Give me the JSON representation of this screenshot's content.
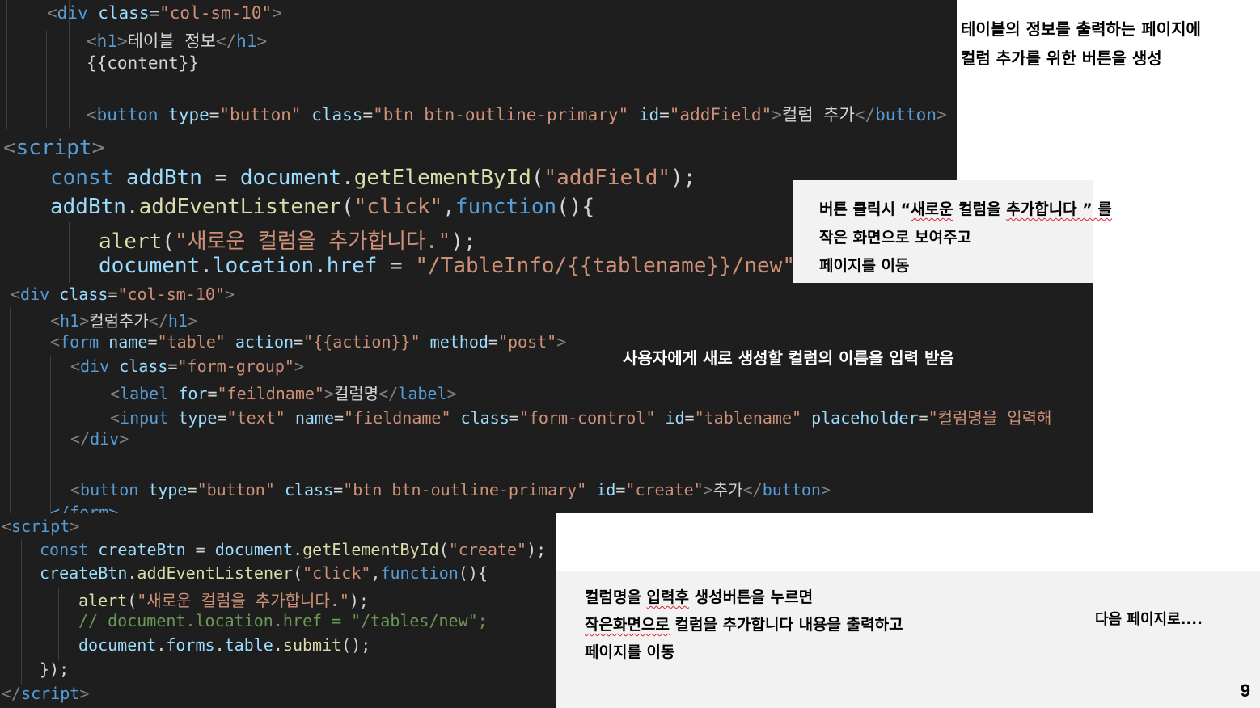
{
  "slide": {
    "page_number": "9",
    "next_page_note": "다음 페이지로....",
    "colors": {
      "editor_bg": "#1e1e1e",
      "note_bg": "#f2f2f2",
      "tag": "#569cd6",
      "attr": "#9cdcfe",
      "string": "#ce9178",
      "function": "#dcdcaa",
      "comment": "#6a9955"
    }
  },
  "code_top": {
    "line1": {
      "indent": "  ",
      "open": "<",
      "tag": "div",
      "attr": "class",
      "eq": "=",
      "val": "\"col-sm-10\"",
      "close": ">"
    },
    "line2": {
      "open": "<",
      "tag": "h1",
      "close": ">",
      "text": "테이블 정보",
      "end_open": "</",
      "end_tag": "h1",
      "end_close": ">"
    },
    "line3": {
      "text": "{{content}}"
    },
    "line4": {
      "open": "<",
      "tag": "button",
      "a1": "type",
      "v1": "\"button\"",
      "a2": "class",
      "v2": "\"btn btn-outline-primary\"",
      "a3": "id",
      "v3": "\"addField\"",
      "close": ">",
      "text": "컬럼 추가",
      "end_open": "</",
      "end_tag": "button",
      "end_close": ">"
    },
    "line5": {
      "open": "<",
      "tag": "script",
      "close": ">"
    },
    "line6": {
      "kw": "const",
      "var": "addBtn",
      "eq": " = ",
      "obj": "document",
      "dot": ".",
      "fn": "getElementById",
      "p1": "(",
      "str": "\"addField\"",
      "p2": ");"
    },
    "line7": {
      "var": "addBtn",
      "dot": ".",
      "fn": "addEventListener",
      "p1": "(",
      "str": "\"click\"",
      "comma": ",",
      "kw": "function",
      "p2": "(){"
    },
    "line8": {
      "fn": "alert",
      "p1": "(",
      "str": "\"새로운 컬럼을 추가합니다.\"",
      "p2": ");"
    },
    "line9": {
      "obj": "document",
      "dot1": ".",
      "p1": "location",
      "dot2": ".",
      "p2": "href",
      "eq": " = ",
      "str": "\"/TableInfo/{{tablename}}/new\"",
      "end": ";"
    }
  },
  "code_bottom": {
    "line1": {
      "open": "<",
      "tag": "div",
      "attr": "class",
      "eq": "=",
      "val": "\"col-sm-10\"",
      "close": ">"
    },
    "line2": {
      "open": "<",
      "tag": "h1",
      "close": ">",
      "text": "컬럼추가",
      "end_open": "</",
      "end_tag": "h1",
      "end_close": ">"
    },
    "line3": {
      "open": "<",
      "tag": "form",
      "a1": "name",
      "v1": "\"table\"",
      "a2": "action",
      "v2": "\"{{action}}\"",
      "a3": "method",
      "v3": "\"post\"",
      "close": ">"
    },
    "line4": {
      "open": "<",
      "tag": "div",
      "attr": "class",
      "val": "\"form-group\"",
      "close": ">"
    },
    "line5": {
      "open": "<",
      "tag": "label",
      "attr": "for",
      "val": "\"feildname\"",
      "close": ">",
      "text": "컬럼명",
      "end_open": "</",
      "end_tag": "label",
      "end_close": ">"
    },
    "line6": {
      "open": "<",
      "tag": "input",
      "a1": "type",
      "v1": "\"text\"",
      "a2": "name",
      "v2": "\"fieldname\"",
      "a3": "class",
      "v3": "\"form-control\"",
      "a4": "id",
      "v4": "\"tablename\"",
      "a5": "placeholder",
      "v5": "\"컬럼명을 입력해"
    },
    "line7": {
      "end_open": "</",
      "end_tag": "div",
      "end_close": ">"
    },
    "line8": {
      "open": "<",
      "tag": "button",
      "a1": "type",
      "v1": "\"button\"",
      "a2": "class",
      "v2": "\"btn btn-outline-primary\"",
      "a3": "id",
      "v3": "\"create\"",
      "close": ">",
      "text": "추가",
      "end_open": "</",
      "end_tag": "button",
      "end_close": ">"
    },
    "line9": {
      "text": "</form>"
    }
  },
  "code_script2": {
    "line1": {
      "open": "<",
      "tag": "script",
      "close": ">"
    },
    "line2": {
      "kw": "const",
      "var": "createBtn",
      "eq": " = ",
      "obj": "document",
      "dot": ".",
      "fn": "getElementById",
      "p1": "(",
      "str": "\"create\"",
      "p2": ");"
    },
    "line3": {
      "var": "createBtn",
      "dot": ".",
      "fn": "addEventListener",
      "p1": "(",
      "str": "\"click\"",
      "comma": ",",
      "kw": "function",
      "p2": "(){"
    },
    "line4": {
      "fn": "alert",
      "p1": "(",
      "str": "\"새로운 컬럼을 추가합니다.\"",
      "p2": ");"
    },
    "line5": {
      "comment": "// document.location.href = \"/tables/new\";"
    },
    "line6": {
      "obj": "document",
      "dot1": ".",
      "p1": "forms",
      "dot2": ".",
      "p2": "table",
      "dot3": ".",
      "fn": "submit",
      "end": "();"
    },
    "line7": {
      "text": "});"
    },
    "line8": {
      "open": "</",
      "tag": "script",
      "close": ">"
    }
  },
  "notes": {
    "note1": {
      "line1": "테이블의 정보를 출력하는 페이지에",
      "line2": "컬럼 추가를 위한 버튼을 생성"
    },
    "note2": {
      "line1a": "버튼 클릭시 “",
      "line1b": "새로운",
      "line1c": " 컬럼을 ",
      "line1d": "추가합니다 ” 를",
      "line2": "작은 화면으로 보여주고",
      "line3": "페이지를 이동"
    },
    "note3": {
      "line1": "사용자에게 새로 생성할 컬럼의 이름을 입력 받음"
    },
    "note4": {
      "line1a": "컬럼명을 ",
      "line1b": "입력후",
      "line1c": " 생성버튼을 누르면",
      "line2a": "작은화면으로",
      "line2b": " 컬럼을 추가합니다 내용을 출력하고",
      "line3": "페이지를 이동"
    }
  }
}
